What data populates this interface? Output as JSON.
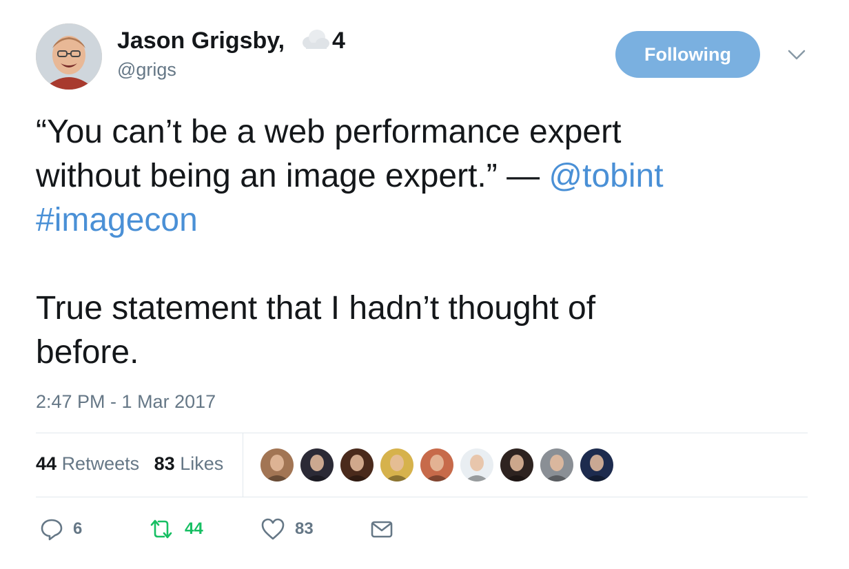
{
  "author": {
    "display_name": "Jason Grigsby,",
    "name_suffix": "4",
    "name_suffix_icon": "cloud-icon",
    "handle": "@grigs"
  },
  "follow_button": {
    "label": "Following",
    "color": "#7ab0e0"
  },
  "tweet": {
    "line1": "“You can’t be a web performance expert",
    "line2_text": "without being an image expert.” — ",
    "mention": "@tobint",
    "hashtag": "#imagecon",
    "line4": "True statement that I hadn’t thought of",
    "line5": "before.",
    "link_color": "#4a90d6"
  },
  "timestamp": "2:47 PM - 1 Mar 2017",
  "stats": {
    "retweets_count": "44",
    "retweets_label": "Retweets",
    "likes_count": "83",
    "likes_label": "Likes"
  },
  "likers": [
    {
      "icon": "avatar",
      "color": "#a27554"
    },
    {
      "icon": "avatar",
      "color": "#2b2a36"
    },
    {
      "icon": "avatar",
      "color": "#4a2a1c"
    },
    {
      "icon": "avatar",
      "color": "#d6b24c"
    },
    {
      "icon": "avatar",
      "color": "#c76a4a"
    },
    {
      "icon": "avatar",
      "color": "#e9eef2"
    },
    {
      "icon": "avatar",
      "color": "#2e2320"
    },
    {
      "icon": "avatar",
      "color": "#8a8f95"
    },
    {
      "icon": "avatar",
      "color": "#1d2b4e"
    }
  ],
  "actions": {
    "reply": {
      "icon": "reply-icon",
      "count": "6"
    },
    "retweet": {
      "icon": "retweet-icon",
      "count": "44",
      "color": "#17bf63"
    },
    "like": {
      "icon": "heart-icon",
      "count": "83"
    },
    "dm": {
      "icon": "envelope-icon"
    }
  }
}
